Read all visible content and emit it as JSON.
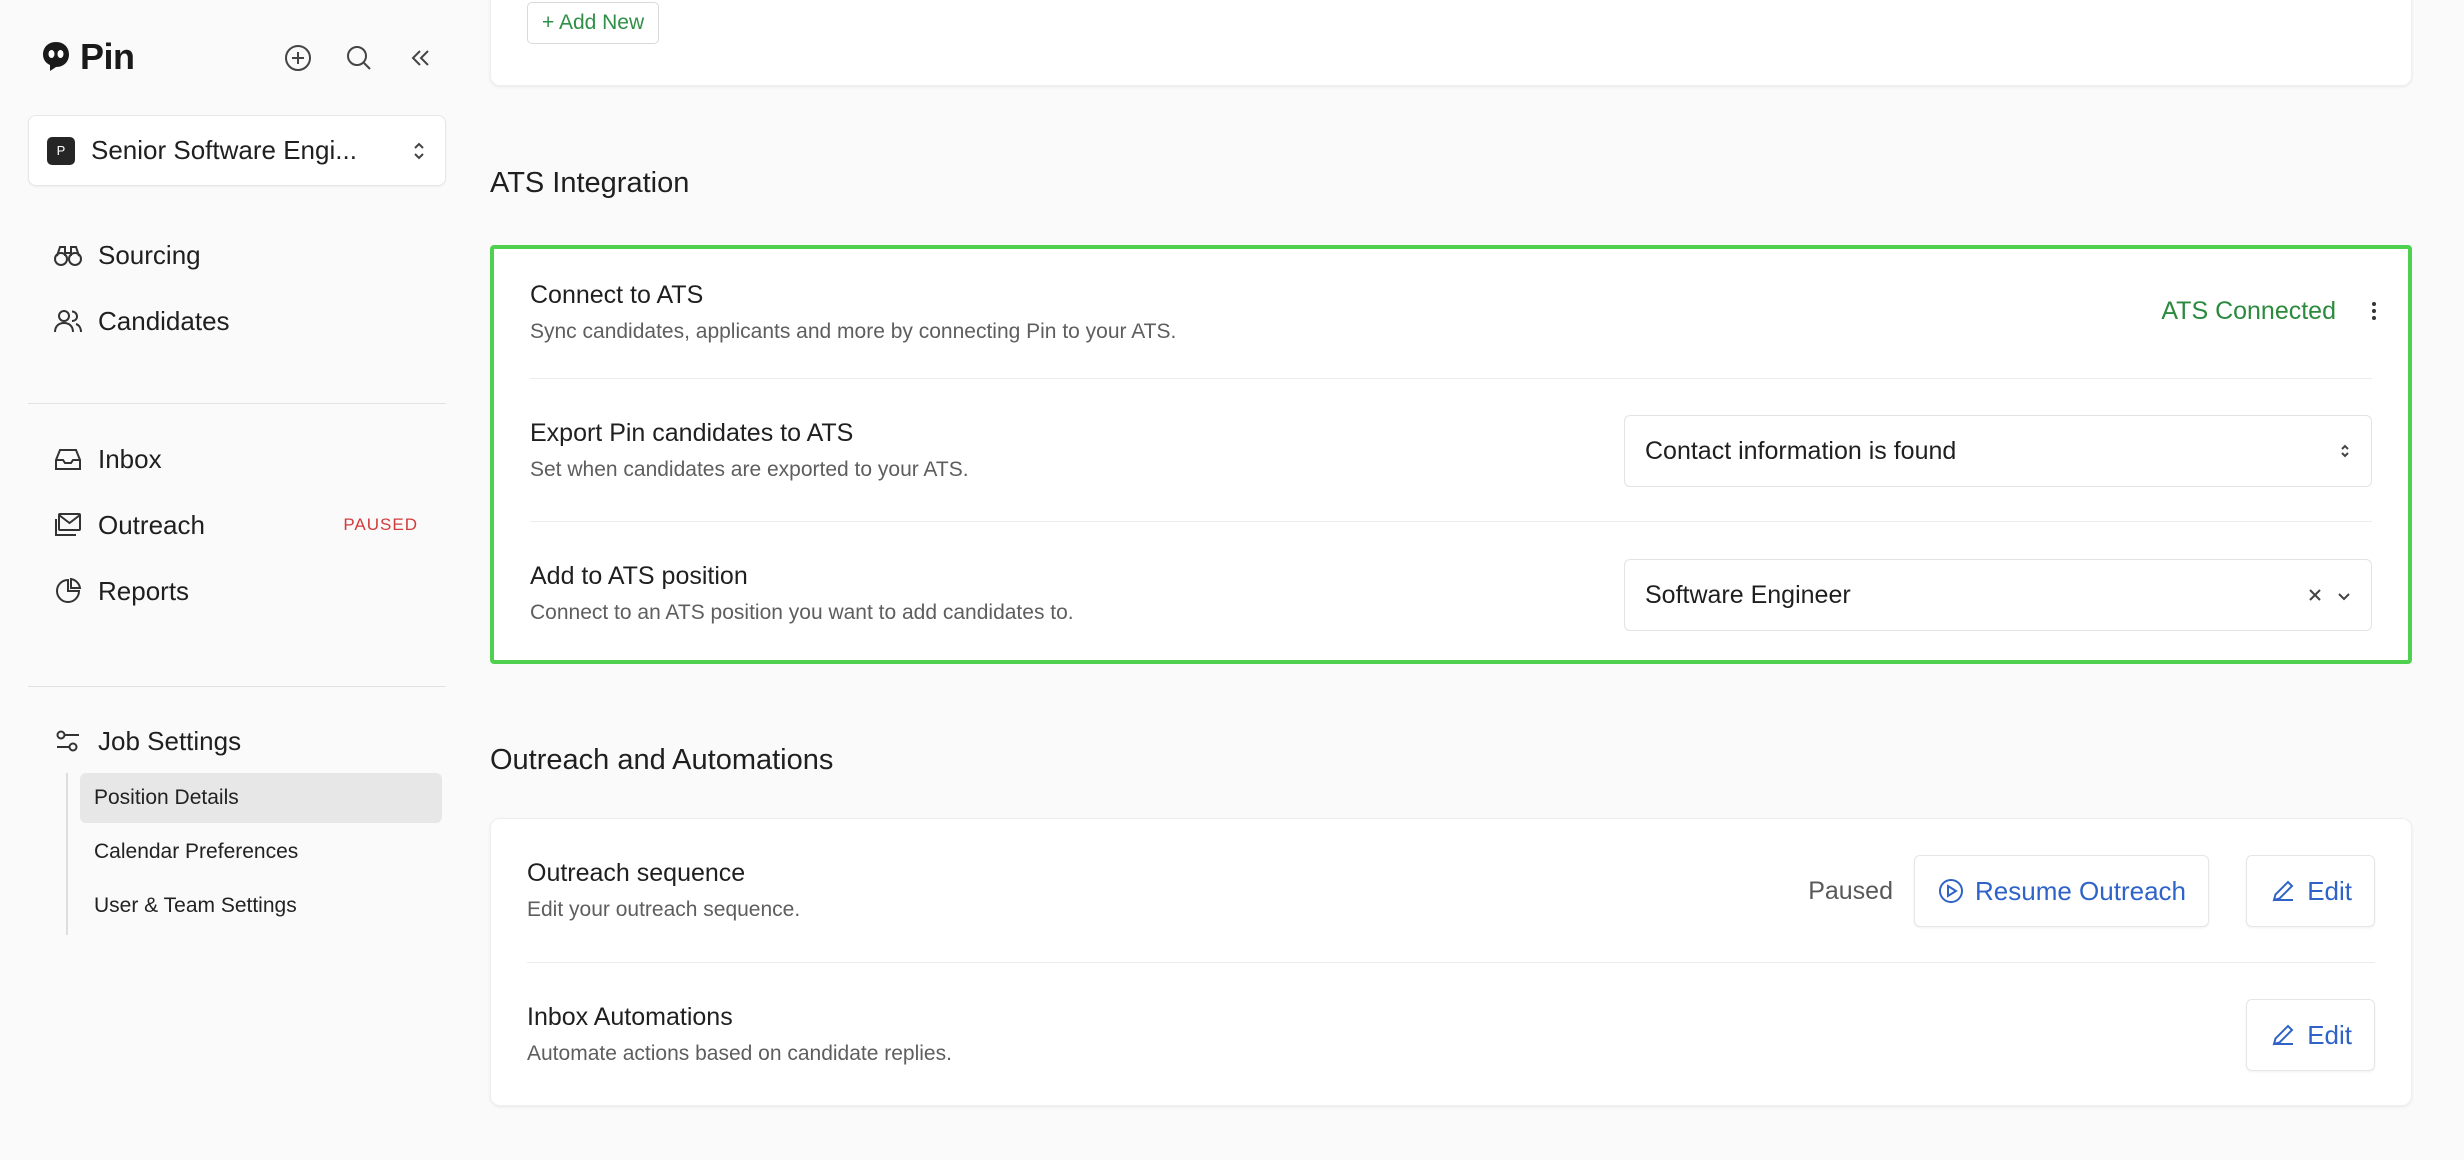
{
  "brand": {
    "name": "Pin"
  },
  "top_icons": [
    "plus-circle-icon",
    "search-icon",
    "collapse-icon"
  ],
  "job_select": {
    "badge": "P",
    "label": "Senior Software Engi..."
  },
  "nav": {
    "sourcing": "Sourcing",
    "candidates": "Candidates",
    "inbox": "Inbox",
    "outreach": "Outreach",
    "outreach_status": "PAUSED",
    "reports": "Reports",
    "job_settings": "Job Settings"
  },
  "subnav": {
    "items": [
      "Position Details",
      "Calendar Preferences",
      "User & Team Settings"
    ],
    "active": "Position Details"
  },
  "top_card": {
    "add_new": "+ Add New"
  },
  "ats": {
    "section_title": "ATS Integration",
    "connect_title": "Connect to ATS",
    "connect_desc": "Sync candidates, applicants and more by connecting Pin to your ATS.",
    "status": "ATS Connected",
    "export_title": "Export Pin candidates to ATS",
    "export_desc": "Set when candidates are exported to your ATS.",
    "export_value": "Contact information is found",
    "position_title": "Add to ATS position",
    "position_desc": "Connect to an ATS position you want to add candidates to.",
    "position_value": "Software Engineer"
  },
  "outreach": {
    "section_title": "Outreach and Automations",
    "seq_title": "Outreach sequence",
    "seq_desc": "Edit your outreach sequence.",
    "seq_status": "Paused",
    "resume_label": "Resume Outreach",
    "edit_label": "Edit",
    "inbox_title": "Inbox Automations",
    "inbox_desc": "Automate actions based on candidate replies.",
    "inbox_edit_label": "Edit"
  },
  "colors": {
    "accent_green": "#2b8a3e",
    "highlight_border": "#4fd14f",
    "link_blue": "#2f63c7",
    "paused_red": "#d13b3b"
  }
}
